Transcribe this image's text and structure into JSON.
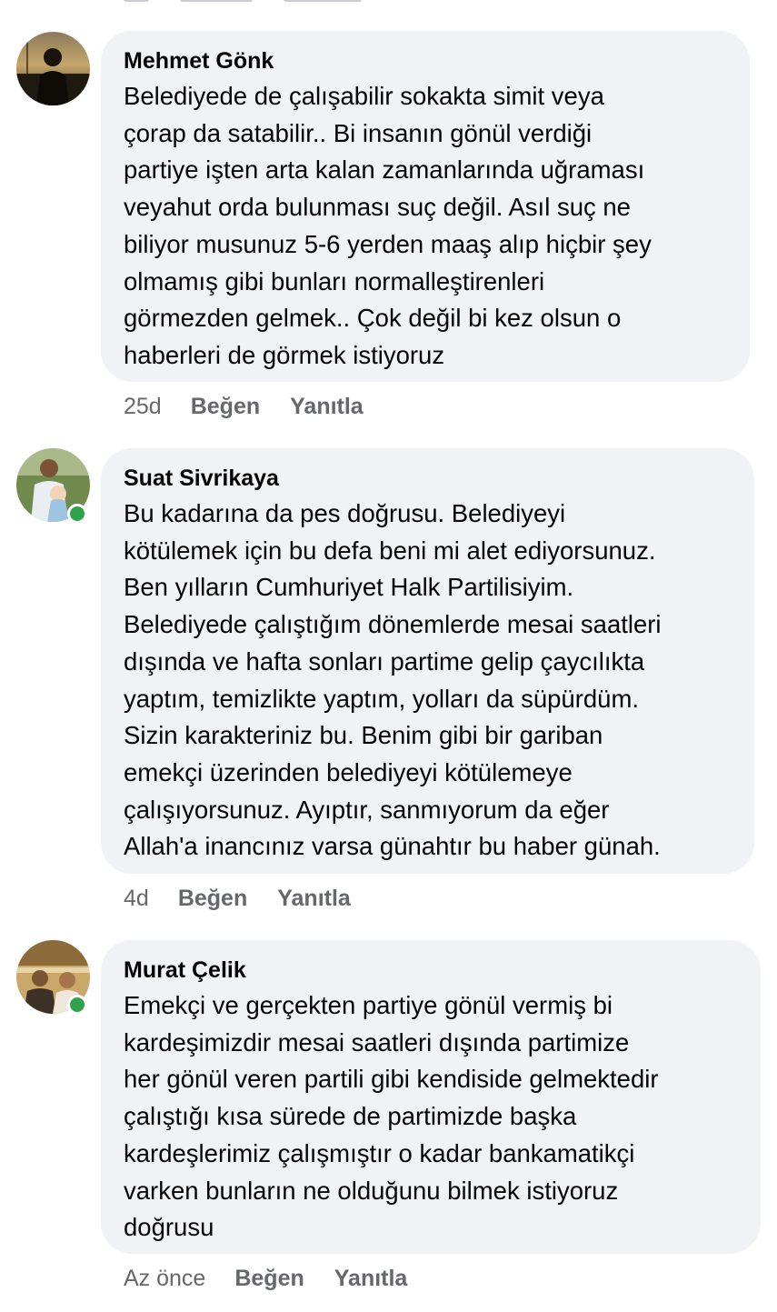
{
  "comments": [
    {
      "author": "Mehmet Gönk",
      "online": false,
      "lines": [
        "Belediyede de çalışabilir sokakta simit veya",
        "çorap da satabilir.. Bi insanın gönül verdiği",
        "partiye işten arta kalan zamanlarında uğraması",
        "veyahut orda bulunması suç değil. Asıl suç ne",
        "biliyor musunuz 5-6 yerden maaş alıp hiçbir şey",
        "olmamış gibi bunları normalleştirenleri",
        "görmezden gelmek.. Çok değil bi kez olsun o",
        "haberleri de görmek istiyoruz"
      ],
      "time": "25d",
      "like_label": "Beğen",
      "reply_label": "Yanıtla"
    },
    {
      "author": "Suat Sivrikaya",
      "online": true,
      "lines": [
        "Bu kadarına da pes doğrusu. Belediyeyi",
        "kötülemek için bu defa beni mi alet ediyorsunuz.",
        "Ben yılların Cumhuriyet Halk Partilisiyim.",
        "Belediyede çalıştığım dönemlerde mesai saatleri",
        "dışında ve hafta sonları partime gelip çaycılıkta",
        "yaptım, temizlikte yaptım, yolları da süpürdüm.",
        "Sizin karakteriniz bu. Benim gibi bir gariban",
        "emekçi üzerinden belediyeyi kötülemeye",
        "çalışıyorsunuz. Ayıptır, sanmıyorum da eğer",
        "Allah'a inancınız varsa günahtır bu haber günah."
      ],
      "time": "4d",
      "like_label": "Beğen",
      "reply_label": "Yanıtla"
    },
    {
      "author": "Murat Çelik",
      "online": true,
      "lines": [
        "Emekçi ve gerçekten partiye gönül vermiş bi",
        "kardeşimizdir mesai saatleri dışında partimize",
        "her gönül veren partili gibi kendiside gelmektedir",
        "çalıştığı kısa sürede de partimizde başka",
        "kardeşlerimiz çalışmıştır o kadar bankamatikçi",
        "varken bunların ne olduğunu bilmek istiyoruz",
        "doğrusu"
      ],
      "time": "Az önce",
      "like_label": "Beğen",
      "reply_label": "Yanıtla"
    }
  ],
  "colors": {
    "bubble": "#f0f2f5",
    "text": "#050505",
    "meta": "#65676b",
    "online": "#31a24c"
  }
}
